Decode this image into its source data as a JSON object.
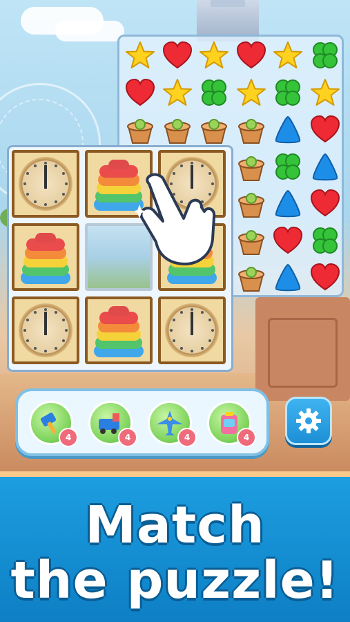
{
  "game": {
    "gem_board": {
      "rows": [
        [
          "star",
          "heart",
          "star",
          "heart",
          "star",
          "clover"
        ],
        [
          "heart",
          "star",
          "clover",
          "star",
          "clover",
          "star"
        ],
        [
          "pot",
          "pot",
          "pot",
          "pot",
          "triangle",
          "heart"
        ],
        [
          "",
          "",
          "",
          "pot",
          "clover",
          "triangle"
        ],
        [
          "",
          "",
          "",
          "pot",
          "triangle",
          "heart"
        ],
        [
          "",
          "",
          "",
          "pot",
          "heart",
          "clover"
        ],
        [
          "",
          "",
          "",
          "pot",
          "triangle",
          "heart"
        ]
      ]
    },
    "tile_board": {
      "rows": [
        [
          "clock",
          "stack",
          "clock"
        ],
        [
          "stack",
          "empty",
          "stack"
        ],
        [
          "clock",
          "stack",
          "clock"
        ]
      ]
    },
    "boosters": [
      {
        "icon": "hammer-icon",
        "count": "4"
      },
      {
        "icon": "train-icon",
        "count": "4"
      },
      {
        "icon": "airplane-icon",
        "count": "4"
      },
      {
        "icon": "rocket-bag-icon",
        "count": "4"
      }
    ],
    "settings_icon": "gear-icon",
    "colors": {
      "star": "#ffd21f",
      "heart": "#ee2a35",
      "clover": "#35c33a",
      "triangle": "#1d8ee8",
      "pot": "#d9904c",
      "banner": "#1690d6"
    }
  },
  "banner": {
    "line1": "Match",
    "line2": "the puzzle!"
  }
}
